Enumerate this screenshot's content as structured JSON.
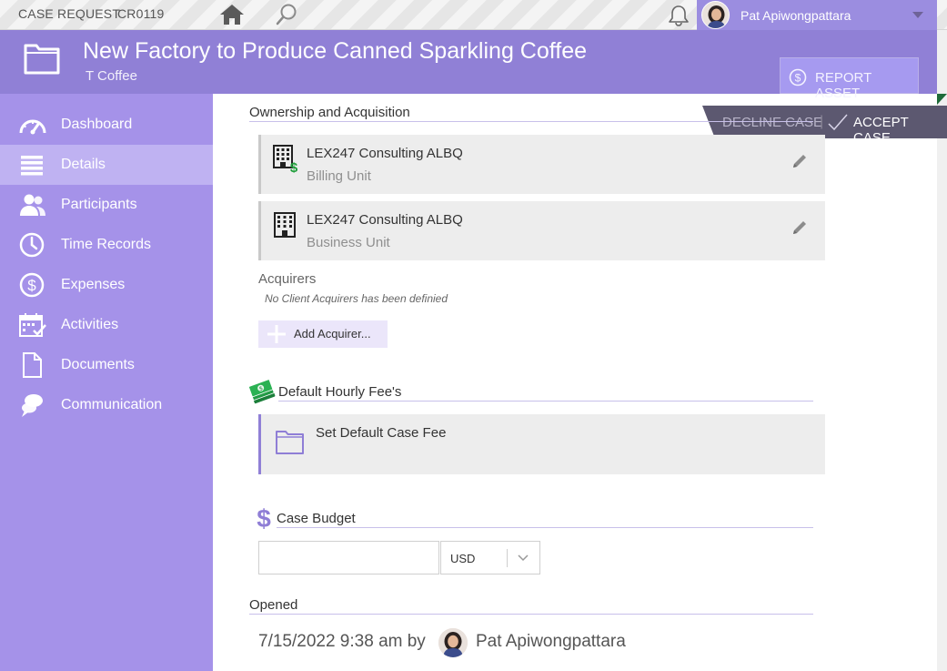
{
  "topbar": {
    "record_type": "CASE REQUEST",
    "record_number": "CR0119",
    "user_name": "Pat Apiwongpattara"
  },
  "header": {
    "title": "New Factory to Produce Canned Sparkling Coffee",
    "client": "T Coffee",
    "report_label": "REPORT ASSET"
  },
  "actions": {
    "decline_label": "DECLINE CASE",
    "divider": "|",
    "accept_label": "ACCEPT CASE"
  },
  "sidebar": {
    "items": [
      {
        "label": "Dashboard",
        "icon": "gauge-icon"
      },
      {
        "label": "Details",
        "icon": "list-icon"
      },
      {
        "label": "Participants",
        "icon": "people-icon"
      },
      {
        "label": "Time Records",
        "icon": "clock-icon"
      },
      {
        "label": "Expenses",
        "icon": "dollar-circle-icon"
      },
      {
        "label": "Activities",
        "icon": "calendar-check-icon"
      },
      {
        "label": "Documents",
        "icon": "document-icon"
      },
      {
        "label": "Communication",
        "icon": "chat-bubbles-icon"
      }
    ],
    "active_index": 1
  },
  "ownership": {
    "heading": "Ownership and Acquisition",
    "billing_unit": {
      "name": "LEX247 Consulting ALBQ",
      "role": "Billing Unit"
    },
    "business_unit": {
      "name": "LEX247 Consulting ALBQ",
      "role": "Business Unit"
    }
  },
  "acquirers": {
    "label": "Acquirers",
    "empty_text": "No Client Acquirers has been definied",
    "add_label": "Add Acquirer..."
  },
  "hourly_fee": {
    "heading": "Default Hourly Fee's",
    "card_label": "Set Default Case Fee"
  },
  "budget": {
    "heading": "Case Budget",
    "value": "",
    "currency": "USD"
  },
  "opened": {
    "heading": "Opened",
    "date_text": "7/15/2022 9:38 am by",
    "user_name": "Pat Apiwongpattara"
  },
  "colors": {
    "sidebar": "#a592e9",
    "header": "#9080d6",
    "accent": "#9b8de0",
    "ribbon": "#5c5870"
  }
}
